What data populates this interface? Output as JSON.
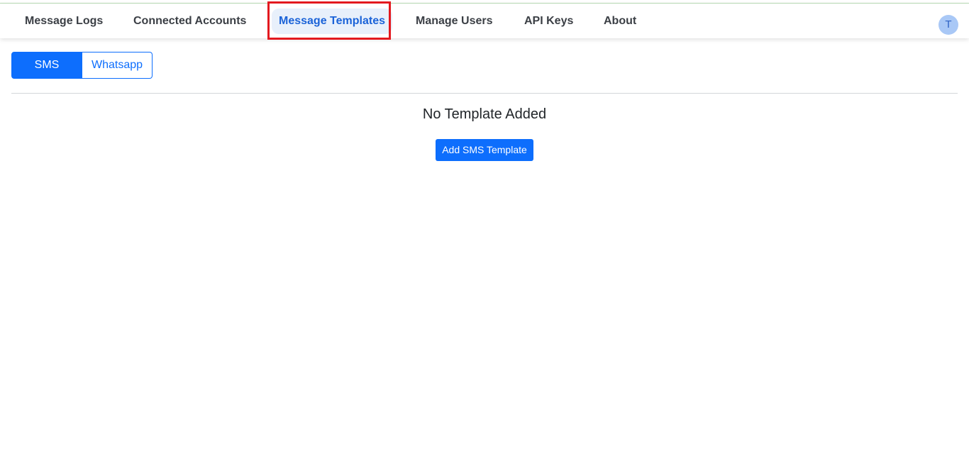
{
  "nav": {
    "items": [
      {
        "label": "Message Logs"
      },
      {
        "label": "Connected Accounts"
      },
      {
        "label": "Message Templates",
        "active": true
      },
      {
        "label": "Manage Users"
      },
      {
        "label": "API Keys"
      },
      {
        "label": "About"
      }
    ],
    "avatar_initial": "T"
  },
  "channel_toggle": {
    "sms_label": "SMS",
    "whatsapp_label": "Whatsapp",
    "selected": "SMS"
  },
  "empty_state": {
    "message": "No Template Added",
    "button_label": "Add SMS Template"
  },
  "colors": {
    "primary": "#0d6efd",
    "active_nav_text": "#1b63d8",
    "active_nav_bg": "#e8f0fb",
    "highlight": "#e3191f",
    "avatar_bg": "#a9c8f6"
  }
}
